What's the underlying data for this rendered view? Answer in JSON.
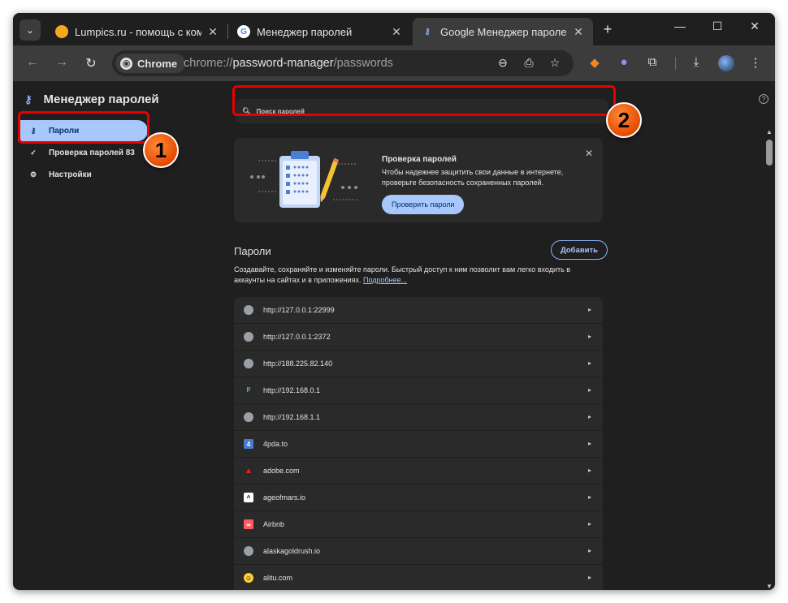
{
  "tabs": [
    {
      "title": "Lumpics.ru - помощь с комп",
      "favicon": "lumpics-icon",
      "active": false
    },
    {
      "title": "Менеджер паролей",
      "favicon": "google-icon",
      "active": false
    },
    {
      "title": "Google Менеджер паролей",
      "favicon": "password-manager-key-icon",
      "active": true
    }
  ],
  "omnibox": {
    "chip_label": "Chrome",
    "url_scheme": "chrome://",
    "url_host": "password-manager",
    "url_path": "/passwords"
  },
  "sidebar": {
    "app_title": "Менеджер паролей",
    "items": [
      {
        "label": "Пароли",
        "icon": "key-icon",
        "active": true
      },
      {
        "label": "Проверка паролей  83",
        "icon": "checkup-icon",
        "active": false
      },
      {
        "label": "Настройки",
        "icon": "gear-icon",
        "active": false
      }
    ]
  },
  "search": {
    "placeholder": "Поиск паролей"
  },
  "promo": {
    "title": "Проверка паролей",
    "description": "Чтобы надежнее защитить свои данные в интернете, проверьте безопасность сохраненных паролей.",
    "button": "Проверить пароли"
  },
  "passwords": {
    "heading": "Пароли",
    "add_button": "Добавить",
    "description": "Создавайте, сохраняйте и изменяйте пароли. Быстрый доступ к ним позволит вам легко входить в аккаунты на сайтах и в приложениях.",
    "learn_more": "Подробнее...",
    "items": [
      {
        "site": "http://127.0.0.1:22999",
        "icon": "globe-icon"
      },
      {
        "site": "http://127.0.0.1:2372",
        "icon": "globe-icon"
      },
      {
        "site": "http://188.225.82.140",
        "icon": "globe-icon"
      },
      {
        "site": "http://192.168.0.1",
        "icon": "tplink-icon"
      },
      {
        "site": "http://192.168.1.1",
        "icon": "globe-icon"
      },
      {
        "site": "4pda.to",
        "icon": "4pda-icon"
      },
      {
        "site": "adobe.com",
        "icon": "adobe-icon"
      },
      {
        "site": "ageofmars.io",
        "icon": "ageofmars-icon"
      },
      {
        "site": "Airbnb",
        "icon": "airbnb-icon"
      },
      {
        "site": "alaskagoldrush.io",
        "icon": "globe-icon"
      },
      {
        "site": "alitu.com",
        "icon": "alitu-icon"
      }
    ]
  },
  "callouts": [
    {
      "number": "1"
    },
    {
      "number": "2"
    }
  ]
}
